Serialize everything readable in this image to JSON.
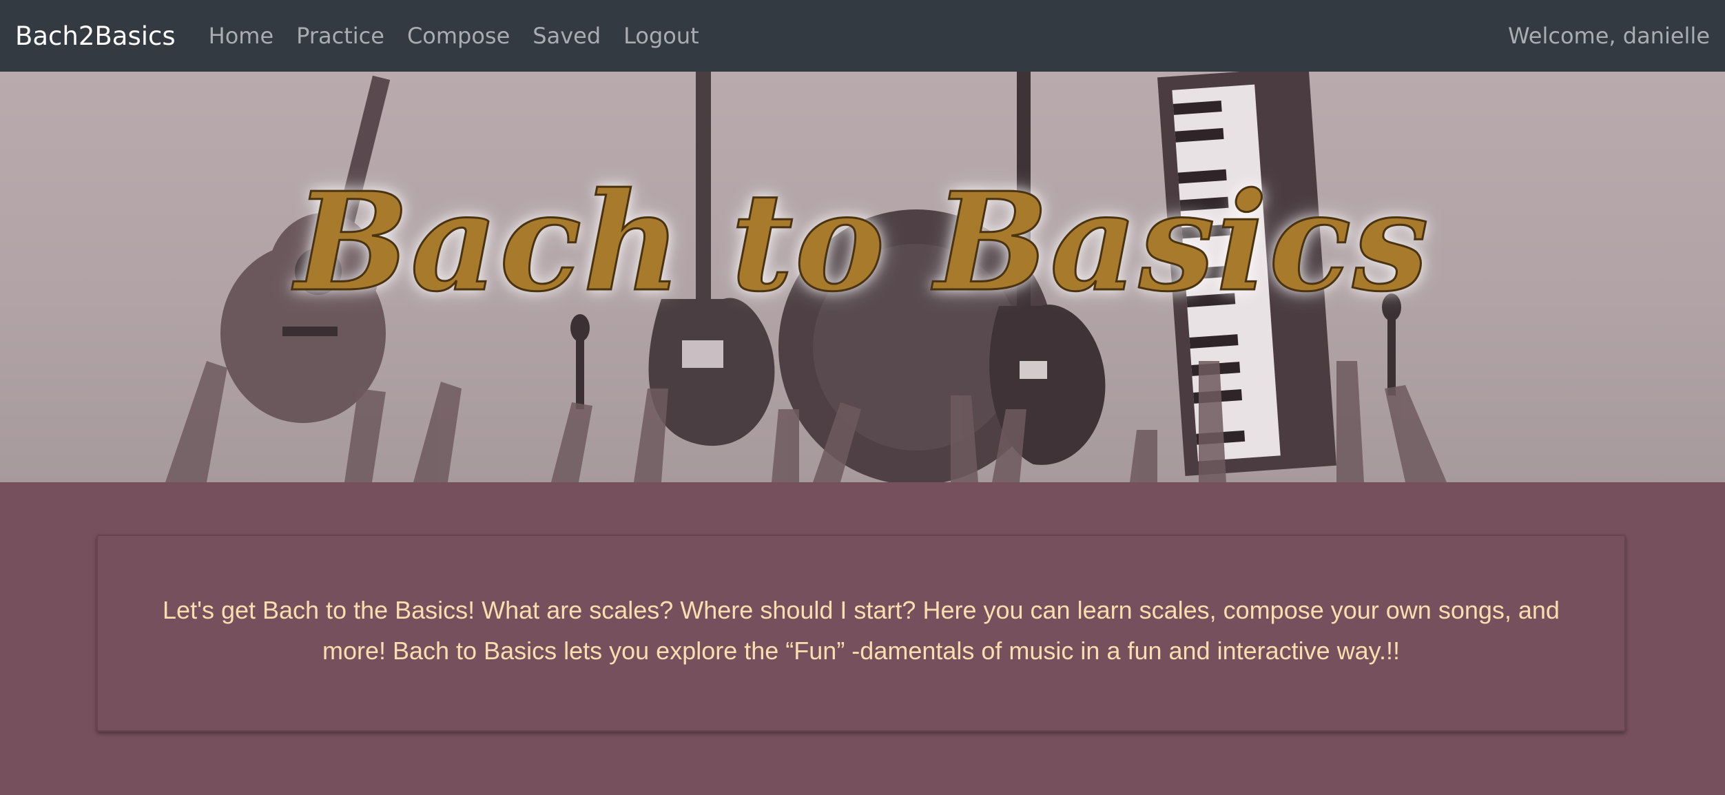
{
  "navbar": {
    "brand": "Bach2Basics",
    "links": [
      {
        "label": "Home"
      },
      {
        "label": "Practice"
      },
      {
        "label": "Compose"
      },
      {
        "label": "Saved"
      },
      {
        "label": "Logout"
      }
    ],
    "welcome": "Welcome, danielle"
  },
  "hero": {
    "title": "Bach to Basics",
    "background_color": "#b5a7aa",
    "title_color": "#a77a2c",
    "image_subject_icons": [
      "acoustic-guitar-icon",
      "electric-guitar-icon",
      "drum-icon",
      "bass-guitar-icon",
      "keyboard-icon",
      "microphone-icon"
    ]
  },
  "main": {
    "description": "Let's get Bach to the Basics! What are scales? Where should I start? Here you can learn scales, compose your own songs, and more! Bach to Basics lets you explore the “Fun” -damentals of music in a fun and interactive way.!!",
    "background_color": "#76505c",
    "text_color": "#f9dfb0"
  }
}
